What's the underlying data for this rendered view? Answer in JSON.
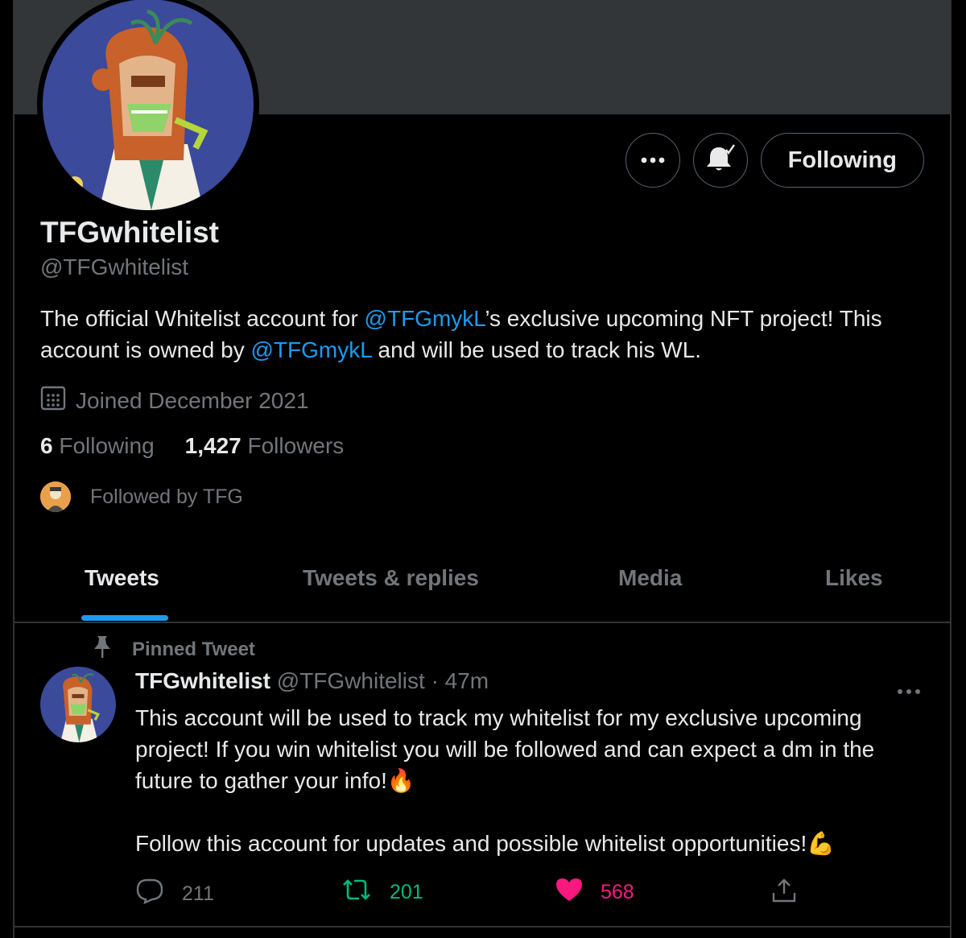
{
  "profile": {
    "name": "TFGwhitelist",
    "handle": "@TFGwhitelist",
    "bio_part1": "The official Whitelist account for ",
    "bio_mention1": "@TFGmykL",
    "bio_part2": "’s exclusive upcoming NFT project! This account is owned by ",
    "bio_mention2": "@TFGmykL",
    "bio_part3": " and will be used to track his WL.",
    "joined": "Joined December 2021",
    "following_count": "6",
    "following_label": "Following",
    "followers_count": "1,427",
    "followers_label": "Followers",
    "followed_by": "Followed by TFG"
  },
  "actions": {
    "more_icon": "more-icon",
    "notify_icon": "bell-check-icon",
    "follow_label": "Following"
  },
  "tabs": [
    {
      "label": "Tweets",
      "active": true
    },
    {
      "label": "Tweets & replies",
      "active": false
    },
    {
      "label": "Media",
      "active": false
    },
    {
      "label": "Likes",
      "active": false
    }
  ],
  "tweet": {
    "pinned_label": "Pinned Tweet",
    "author": "TFGwhitelist",
    "handle": "@TFGwhitelist",
    "time": "· 47m",
    "line1": "This account will be used to track my whitelist for my exclusive upcoming project! If you win whitelist you will be followed and can expect a dm in the future to gather your info!",
    "line1_emoji": "🔥",
    "line2": "Follow this account for updates and possible whitelist opportunities!",
    "line2_emoji": "💪",
    "replies": "211",
    "retweets": "201",
    "likes": "568"
  },
  "colors": {
    "accent": "#1d9bf0",
    "retweet": "#00ba7c",
    "like": "#f91880",
    "muted": "#71767b"
  }
}
